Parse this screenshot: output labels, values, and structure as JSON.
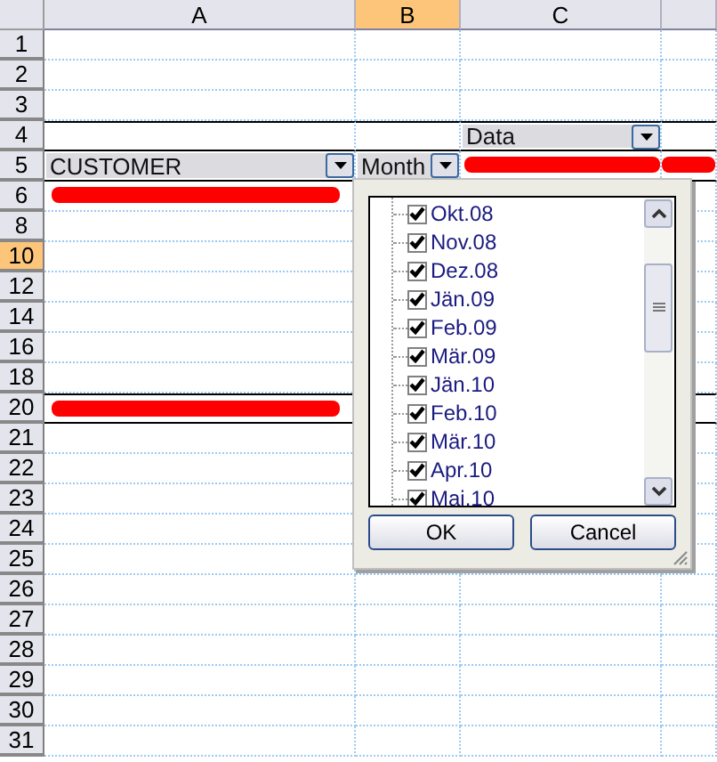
{
  "columns": [
    {
      "label": "A",
      "selected": false
    },
    {
      "label": "B",
      "selected": true
    },
    {
      "label": "C",
      "selected": false
    }
  ],
  "rows": [
    {
      "label": "1",
      "selected": false,
      "kind": "plain"
    },
    {
      "label": "2",
      "selected": false,
      "kind": "plain"
    },
    {
      "label": "3",
      "selected": false,
      "kind": "plain"
    },
    {
      "label": "4",
      "selected": false,
      "kind": "data-header"
    },
    {
      "label": "5",
      "selected": false,
      "kind": "field-header"
    },
    {
      "label": "6",
      "selected": false,
      "kind": "detail"
    },
    {
      "label": "8",
      "selected": false,
      "kind": "plain"
    },
    {
      "label": "10",
      "selected": true,
      "kind": "plain"
    },
    {
      "label": "12",
      "selected": false,
      "kind": "plain"
    },
    {
      "label": "14",
      "selected": false,
      "kind": "plain"
    },
    {
      "label": "16",
      "selected": false,
      "kind": "plain"
    },
    {
      "label": "18",
      "selected": false,
      "kind": "plain"
    },
    {
      "label": "20",
      "selected": false,
      "kind": "total"
    },
    {
      "label": "21",
      "selected": false,
      "kind": "plain"
    },
    {
      "label": "22",
      "selected": false,
      "kind": "plain"
    },
    {
      "label": "23",
      "selected": false,
      "kind": "plain"
    },
    {
      "label": "24",
      "selected": false,
      "kind": "plain"
    },
    {
      "label": "25",
      "selected": false,
      "kind": "plain"
    },
    {
      "label": "26",
      "selected": false,
      "kind": "plain"
    },
    {
      "label": "27",
      "selected": false,
      "kind": "plain"
    },
    {
      "label": "28",
      "selected": false,
      "kind": "plain"
    },
    {
      "label": "29",
      "selected": false,
      "kind": "plain"
    },
    {
      "label": "30",
      "selected": false,
      "kind": "plain"
    },
    {
      "label": "31",
      "selected": false,
      "kind": "plain"
    }
  ],
  "pivot": {
    "data_field": "Data",
    "row_field": "CUSTOMER",
    "column_field": "Month"
  },
  "filter_popup": {
    "items": [
      {
        "label": "Okt.08",
        "checked": true
      },
      {
        "label": "Nov.08",
        "checked": true
      },
      {
        "label": "Dez.08",
        "checked": true
      },
      {
        "label": "Jän.09",
        "checked": true
      },
      {
        "label": "Feb.09",
        "checked": true
      },
      {
        "label": "Mär.09",
        "checked": true
      },
      {
        "label": "Jän.10",
        "checked": true
      },
      {
        "label": "Feb.10",
        "checked": true
      },
      {
        "label": "Mär.10",
        "checked": true
      },
      {
        "label": "Apr.10",
        "checked": true
      },
      {
        "label": "Mai.10",
        "checked": true
      }
    ],
    "buttons": [
      "OK",
      "Cancel"
    ]
  }
}
